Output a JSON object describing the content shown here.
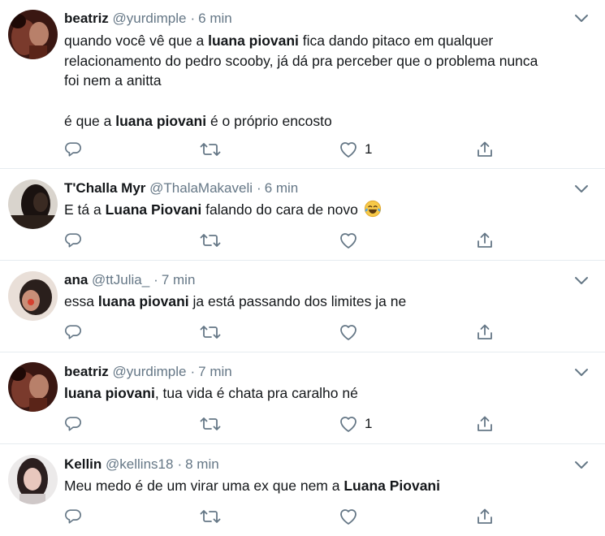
{
  "tweets": [
    {
      "name": "beatriz",
      "handle": "@yurdimple",
      "separator": "·",
      "time": "6 min",
      "lines": [
        [
          {
            "t": "quando você vê que a "
          },
          {
            "t": "luana piovani",
            "b": true
          },
          {
            "t": " fica dando pitaco em qualquer"
          }
        ],
        [
          {
            "t": "relacionamento do pedro scooby, já dá pra perceber que o problema nunca"
          }
        ],
        [
          {
            "t": "foi nem a anitta"
          }
        ],
        [],
        [
          {
            "t": "é que a "
          },
          {
            "t": "luana piovani",
            "b": true
          },
          {
            "t": " é o próprio encosto"
          }
        ]
      ],
      "like_count": "1"
    },
    {
      "name": "T'Challa Myr",
      "handle": "@ThalaMakaveli",
      "separator": "·",
      "time": "6 min",
      "lines": [
        [
          {
            "t": "E tá a "
          },
          {
            "t": "Luana Piovani",
            "b": true
          },
          {
            "t": " falando do cara de novo "
          },
          {
            "emoji": "face-with-tears-of-joy"
          }
        ]
      ],
      "like_count": ""
    },
    {
      "name": "ana",
      "handle": "@ttJulia_",
      "separator": "·",
      "time": "7 min",
      "lines": [
        [
          {
            "t": "essa "
          },
          {
            "t": "luana piovani",
            "b": true
          },
          {
            "t": " ja está passando dos limites ja ne"
          }
        ]
      ],
      "like_count": ""
    },
    {
      "name": "beatriz",
      "handle": "@yurdimple",
      "separator": "·",
      "time": "7 min",
      "lines": [
        [
          {
            "t": "luana piovani",
            "b": true
          },
          {
            "t": ", tua vida é chata pra caralho né"
          }
        ]
      ],
      "like_count": "1"
    },
    {
      "name": "Kellin",
      "handle": "@kellins18",
      "separator": "·",
      "time": "8 min",
      "lines": [
        [
          {
            "t": "Meu medo é de um  virar uma ex que nem a "
          },
          {
            "t": "Luana Piovani",
            "b": true
          }
        ]
      ],
      "like_count": ""
    }
  ],
  "icons": {
    "reply": "reply-icon",
    "retweet": "retweet-icon",
    "like": "heart-icon",
    "share": "share-icon",
    "more": "chevron-down-icon"
  },
  "colors": {
    "text": "#14171a",
    "secondary": "#657786",
    "icon": "#657786",
    "divider": "#e6ecf0"
  }
}
